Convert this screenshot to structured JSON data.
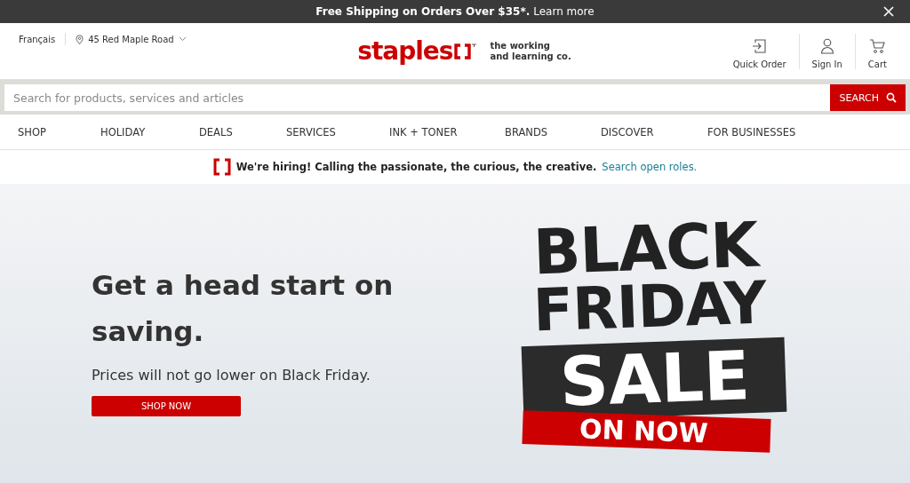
{
  "promo_bar": {
    "text": "Free Shipping on Orders Over $35*.",
    "link": "Learn more"
  },
  "header": {
    "language": "Français",
    "location": "45 Red Maple Road",
    "logo": "staples",
    "tagline": [
      "the working",
      "and learning co."
    ],
    "actions": [
      {
        "label": "Quick Order",
        "kind": "quick"
      },
      {
        "label": "Sign In",
        "kind": "user"
      },
      {
        "label": "Cart",
        "kind": "cart"
      }
    ]
  },
  "search": {
    "placeholder": "Search for products, services and articles",
    "button": "SEARCH"
  },
  "nav": [
    "SHOP",
    "HOLIDAY",
    "DEALS",
    "SERVICES",
    "INK + TONER",
    "BRANDS",
    "DISCOVER",
    "FOR BUSINESSES"
  ],
  "hiring": {
    "text": "We're hiring! Calling the passionate, the curious, the creative.",
    "link": "Search open roles."
  },
  "hero": {
    "heading": "Get a head start on saving.",
    "subheading": "Prices will not go lower on Black Friday.",
    "button": "SHOP NOW",
    "banner": {
      "line_1": "BLACK",
      "line_2": "FRIDAY",
      "sale": "SALE",
      "ribbon": "ON NOW"
    }
  }
}
